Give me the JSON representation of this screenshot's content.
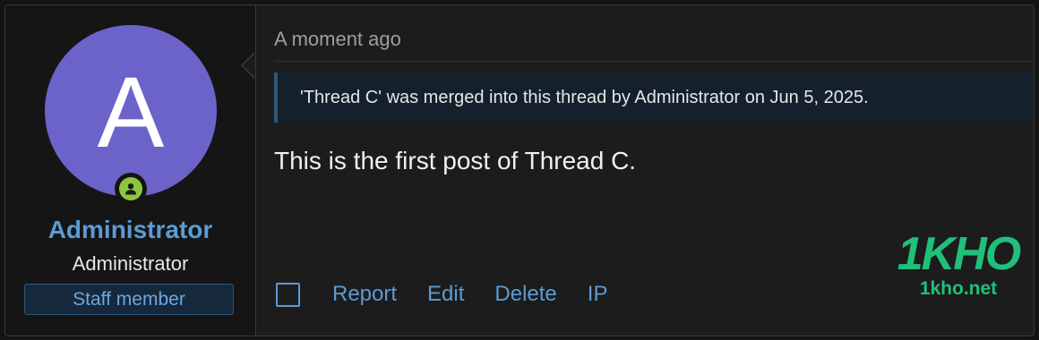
{
  "user": {
    "avatar_letter": "A",
    "avatar_color": "#6b63c9",
    "online_indicator_icon": "user-icon",
    "name": "Administrator",
    "title": "Administrator",
    "banner": "Staff member"
  },
  "post": {
    "date": "A moment ago",
    "merge_notice": "'Thread C' was merged into this thread by Administrator on Jun 5, 2025.",
    "body": "This is the first post of Thread C."
  },
  "actions": {
    "select_icon": "checkbox-icon",
    "report": "Report",
    "edit": "Edit",
    "delete": "Delete",
    "ip": "IP"
  },
  "watermark": {
    "logo": "1KHO",
    "url": "1kho.net"
  },
  "colors": {
    "accent": "#5b9bd5",
    "online": "#8cc63f",
    "background": "#1c1c1c"
  }
}
